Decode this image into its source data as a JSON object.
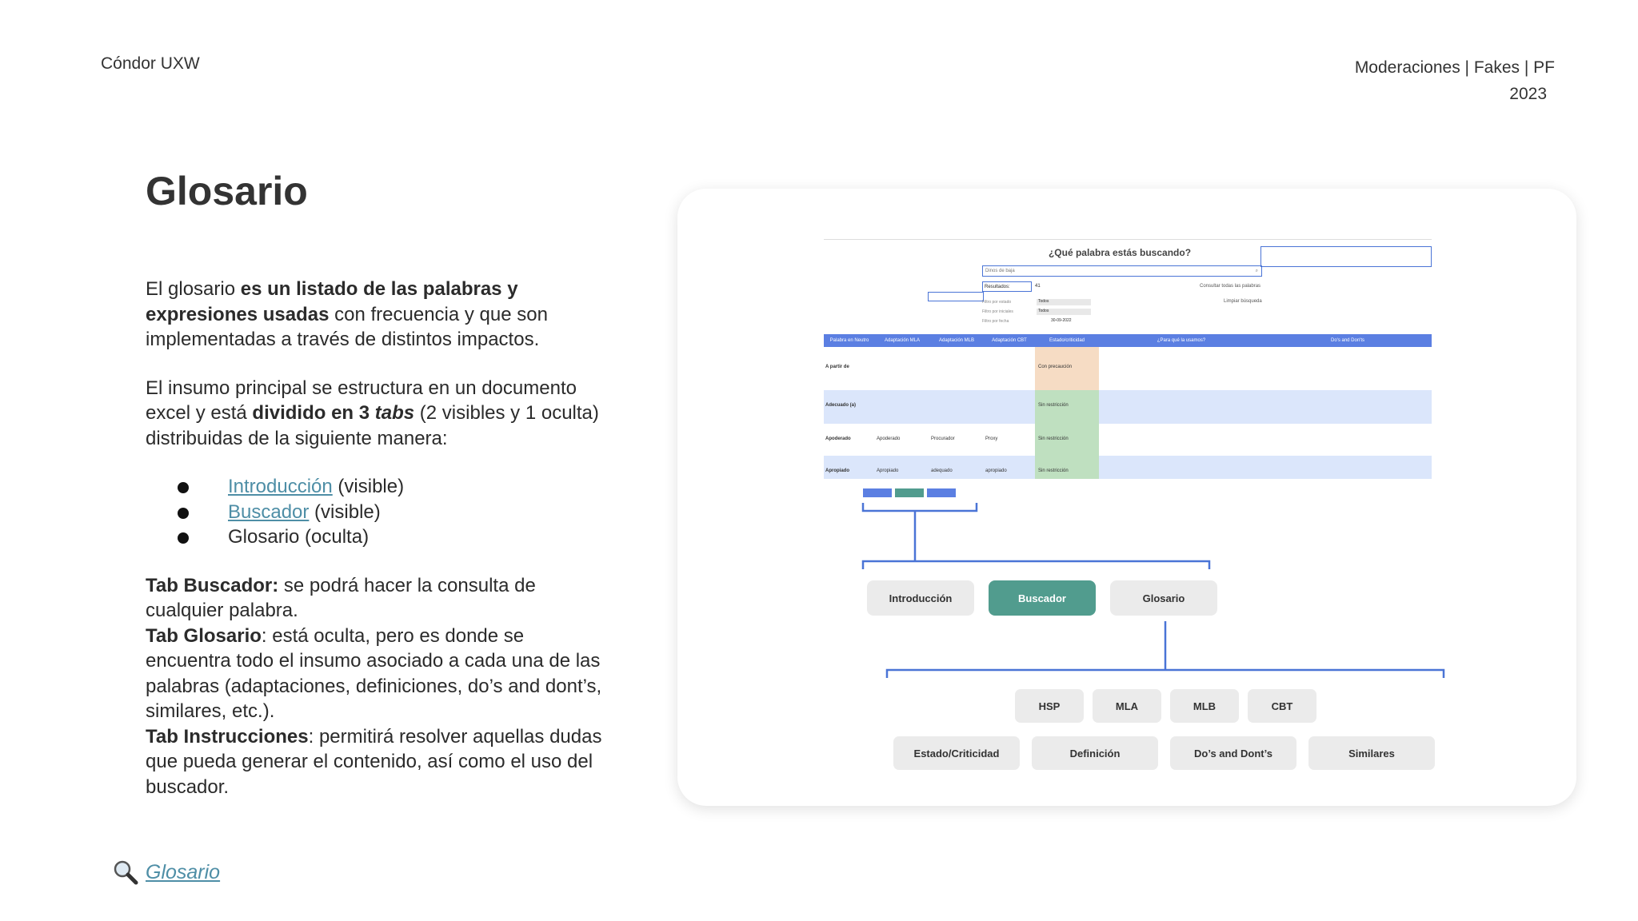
{
  "header": {
    "brand": "Cóndor UXW",
    "project": "Moderaciones | Fakes | PF",
    "year": "2023"
  },
  "page_title": "Glosario",
  "intro": {
    "p1_a": "El glosario ",
    "p1_b": "es un listado de las palabras y expresiones usadas",
    "p1_c": " con frecuencia y que son implementadas a través de distintos impactos.",
    "p2_a": "El insumo principal se estructura en un documento excel y está ",
    "p2_b": "dividido en 3 ",
    "p2_c": "tabs",
    "p2_d": " (2 visibles y 1 oculta) distribuidas de la siguiente manera:"
  },
  "tabs_list": [
    {
      "link": "Introducción",
      "note": " (visible)"
    },
    {
      "link": "Buscador",
      "note": " (visible)"
    },
    {
      "text": "Glosario (oculta)"
    }
  ],
  "tab_desc": {
    "buscador_label": "Tab Buscador:",
    "buscador_text": " se podrá hacer la consulta de cualquier palabra.",
    "glosario_label": "Tab Glosario",
    "glosario_text": ": está oculta, pero es donde se encuentra todo el insumo asociado a cada una de las palabras (adaptaciones, definiciones, do’s and dont’s, similares, etc.).",
    "instrucciones_label": "Tab Instrucciones",
    "instrucciones_text": ": permitirá resolver aquellas dudas que pueda generar el contenido, así como el uso del buscador."
  },
  "footer_link": "Glosario",
  "spreadsheet": {
    "search_title": "¿Qué palabra estás buscando?",
    "search_value": "Dinos de baja",
    "results_label": "Resultados:",
    "results_count": "41",
    "consult_all": "Consultar todas las palabras",
    "clear_search": "Limpiar búsqueda",
    "filters": [
      {
        "label": "Filtro por estado",
        "value": "Todos"
      },
      {
        "label": "Filtro por iniciales",
        "value": "Todos"
      },
      {
        "label": "Filtro por fecha",
        "value": "30-09-2022"
      }
    ],
    "columns": [
      "Palabra en Neutro",
      "Adaptación MLA",
      "Adaptación MLB",
      "Adaptación CBT",
      "Estado/criticidad",
      "¿Para qué la usamos?",
      "Do's and Don'ts"
    ],
    "rows": [
      {
        "word": "A partir de",
        "status": "Con precaución"
      },
      {
        "word": "Adecuado (a)",
        "status": "Sin restricción"
      },
      {
        "word": "Apoderado",
        "mla": "Apoderado",
        "mlb": "Procurador",
        "cbt": "Proxy",
        "status": "Sin restricción"
      },
      {
        "word": "Apropiado",
        "mla": "Apropiado",
        "mlb": "adequado",
        "cbt": "apropiado",
        "status": "Sin restricción"
      }
    ]
  },
  "diagram": {
    "tabs": [
      "Introducción",
      "Buscador",
      "Glosario"
    ],
    "sites": [
      "HSP",
      "MLA",
      "MLB",
      "CBT"
    ],
    "fields": [
      "Estado/Criticidad",
      "Definición",
      "Do’s and Dont’s",
      "Similares"
    ],
    "colors": {
      "active_tab": "#519c8e",
      "connector": "#4a74d6",
      "sheet_header": "#5b7fe2"
    }
  }
}
